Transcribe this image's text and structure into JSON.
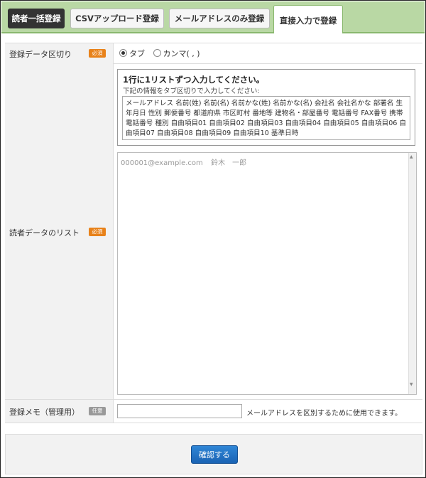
{
  "tabs": [
    {
      "label": "読者一括登録"
    },
    {
      "label": "CSVアップロード登録"
    },
    {
      "label": "メールアドレスのみ登録"
    },
    {
      "label": "直接入力で登録"
    }
  ],
  "delimiter": {
    "label": "登録データ区切り",
    "badge": "必須",
    "options": [
      {
        "label": "タブ",
        "selected": true
      },
      {
        "label": "カンマ( , )",
        "selected": false
      }
    ]
  },
  "list": {
    "label": "読者データのリスト",
    "badge": "必須",
    "help_title": "1行に1リストずつ入力してください。",
    "help_subtitle": "下記の情報をタブ区切りで入力してください:",
    "fields_text": "メールアドレス 名前(姓) 名前(名) 名前かな(姓) 名前かな(名) 会社名 会社名かな 部署名 生年月日 性別 郵便番号 都道府県 市区町村 番地等 建物名・部屋番号 電話番号 FAX番号 携帯電話番号 種別 自由項目01 自由項目02 自由項目03 自由項目04 自由項目05 自由項目06 自由項目07 自由項目08 自由項目09 自由項目10 基準日時",
    "placeholder": "000001@example.com\t鈴木　一郎"
  },
  "memo": {
    "label": "登録メモ（管理用）",
    "badge": "任意",
    "value": "",
    "note": "メールアドレスを区別するために使用できます。"
  },
  "footer": {
    "confirm_label": "確認する"
  },
  "colors": {
    "tab_bar": "#b9d8a4",
    "required_badge": "#e8821a",
    "optional_badge": "#999999",
    "confirm_button": "#1a63b4"
  }
}
